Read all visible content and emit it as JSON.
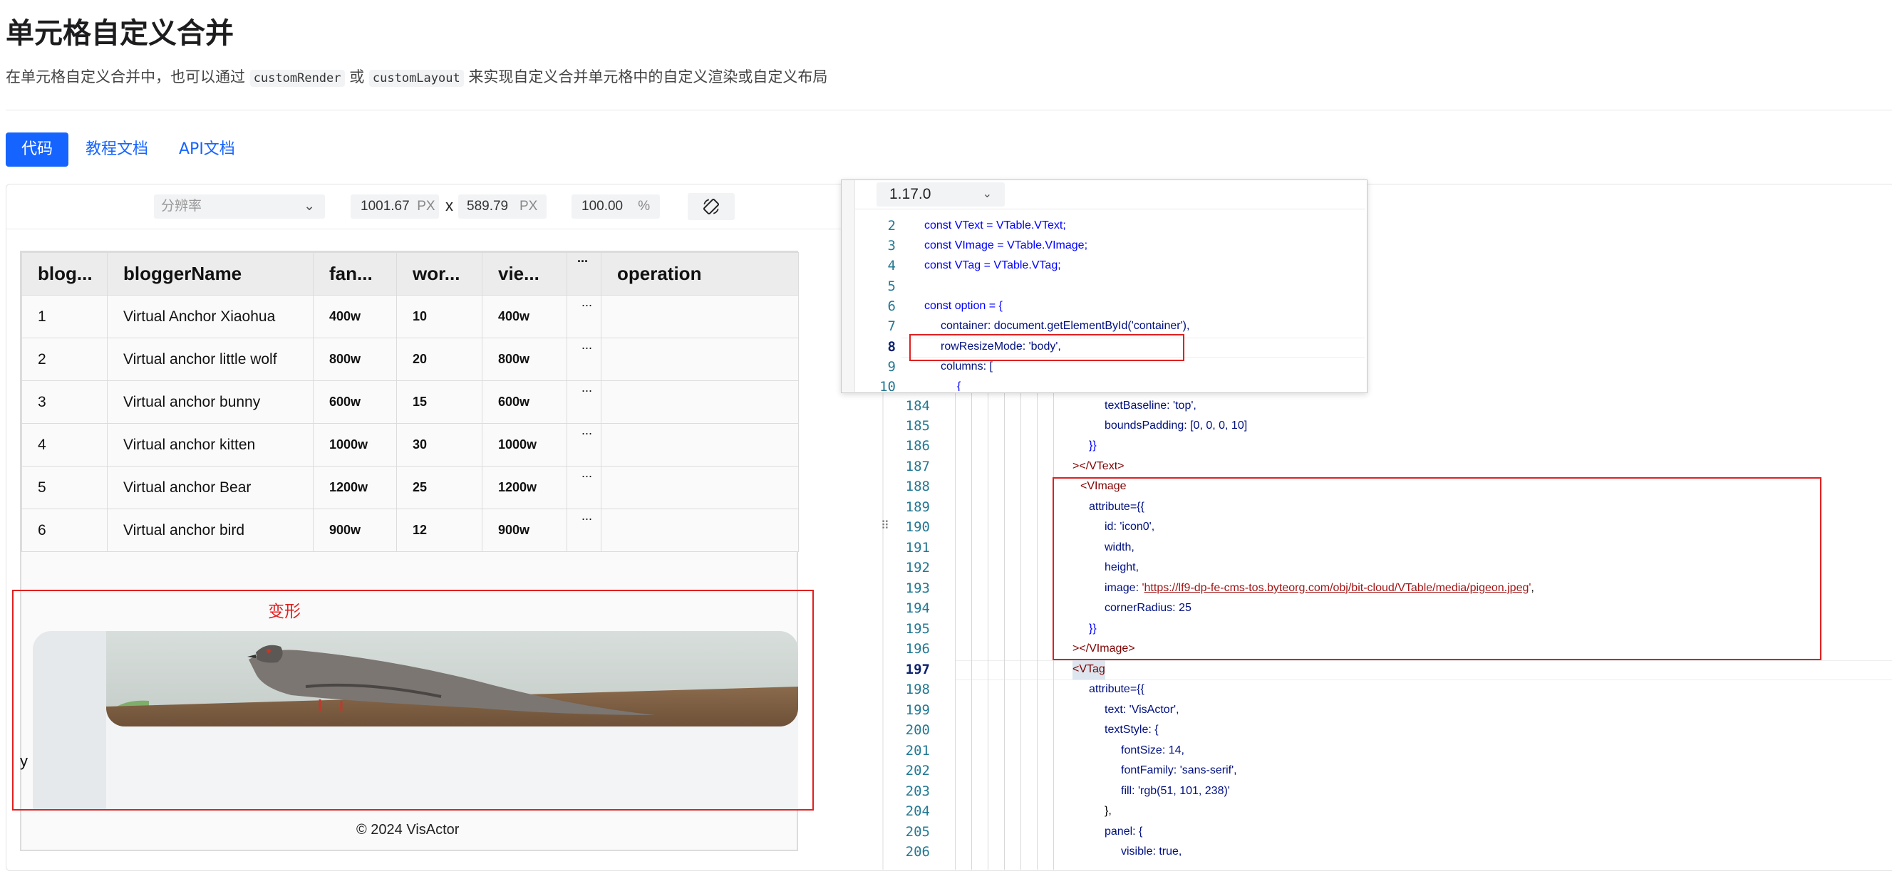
{
  "header": {
    "title": "单元格自定义合并",
    "desc_prefix": "在单元格自定义合并中，也可以通过",
    "code1": "customRender",
    "desc_or": "或",
    "code2": "customLayout",
    "desc_suffix": "来实现自定义合并单元格中的自定义渲染或自定义布局"
  },
  "tabs": [
    {
      "label": "代码",
      "active": true
    },
    {
      "label": "教程文档",
      "active": false
    },
    {
      "label": "API文档",
      "active": false
    }
  ],
  "toolbar": {
    "resolution_placeholder": "分辨率",
    "width_value": "1001.67",
    "height_value": "589.79",
    "unit_px": "PX",
    "times": "x",
    "zoom_value": "100.00",
    "zoom_unit": "%"
  },
  "table": {
    "headers": [
      "blog...",
      "bloggerName",
      "fan...",
      "wor...",
      "vie...",
      "...",
      "operation"
    ],
    "rows": [
      [
        "1",
        "Virtual Anchor Xiaohua",
        "400w",
        "10",
        "400w",
        "..."
      ],
      [
        "2",
        "Virtual anchor little wolf",
        "800w",
        "20",
        "800w",
        "..."
      ],
      [
        "3",
        "Virtual anchor bunny",
        "600w",
        "15",
        "600w",
        "..."
      ],
      [
        "4",
        "Virtual anchor kitten",
        "1000w",
        "30",
        "1000w",
        "..."
      ],
      [
        "5",
        "Virtual anchor Bear",
        "1200w",
        "25",
        "1200w",
        "..."
      ],
      [
        "6",
        "Virtual anchor bird",
        "900w",
        "12",
        "900w",
        "..."
      ]
    ]
  },
  "annotation": {
    "deform_label": "变形",
    "y_label": "y"
  },
  "footer": "© 2024 VisActor",
  "popup": {
    "version": "1.17.0",
    "line_numbers": [
      "2",
      "3",
      "4",
      "5",
      "6",
      "7",
      "8",
      "9",
      "10"
    ],
    "current_line": "8"
  },
  "editor": {
    "line_numbers": [
      "184",
      "185",
      "186",
      "187",
      "188",
      "189",
      "190",
      "191",
      "192",
      "193",
      "194",
      "195",
      "196",
      "197",
      "198",
      "199",
      "200",
      "201",
      "202",
      "203",
      "204",
      "205",
      "206"
    ],
    "current_line": "197",
    "drag_handle": "⠿"
  },
  "code": {
    "vtext_decl": "const VText = VTable.VText;",
    "vimage_decl": "const VImage = VTable.VImage;",
    "vtag_decl": "const VTag = VTable.VTag;",
    "option_open": "const option = {",
    "container_line": "container: document.getElementById('container'),",
    "resize_line": "rowResizeMode: 'body',",
    "columns_line": "columns: [",
    "brace_open": "{",
    "text_baseline": "textBaseline: 'top',",
    "bounds_padding": "boundsPadding: [0, 0, 0, 10]",
    "close_dbl": "}}",
    "close_vtext": "></VText>",
    "open_vimage": "<VImage",
    "attribute_open": "attribute={{",
    "id_line": "id: 'icon0',",
    "width_line": "width,",
    "height_line": "height,",
    "image_key": "image: ",
    "image_url": "https://lf9-dp-fe-cms-tos.byteorg.com/obj/bit-cloud/VTable/media/pigeon.jpeg",
    "corner_radius": "cornerRadius: 25",
    "close_vimage": "></VImage>",
    "open_vtag": "<VTag",
    "text_vis": "text: 'VisActor',",
    "text_style_open": "textStyle: {",
    "font_size": "fontSize: 14,",
    "font_family": "fontFamily: 'sans-serif',",
    "fill_line": "fill: 'rgb(51, 101, 238)'",
    "close_obj": "},",
    "panel_open": "panel: {",
    "visible_line": "visible: true,"
  },
  "colors": {
    "accent": "#1664ff",
    "annotation_red": "#e02020"
  },
  "icons": {
    "rotate": "rotate-screen-icon",
    "chevron": "chevron-down-icon"
  }
}
